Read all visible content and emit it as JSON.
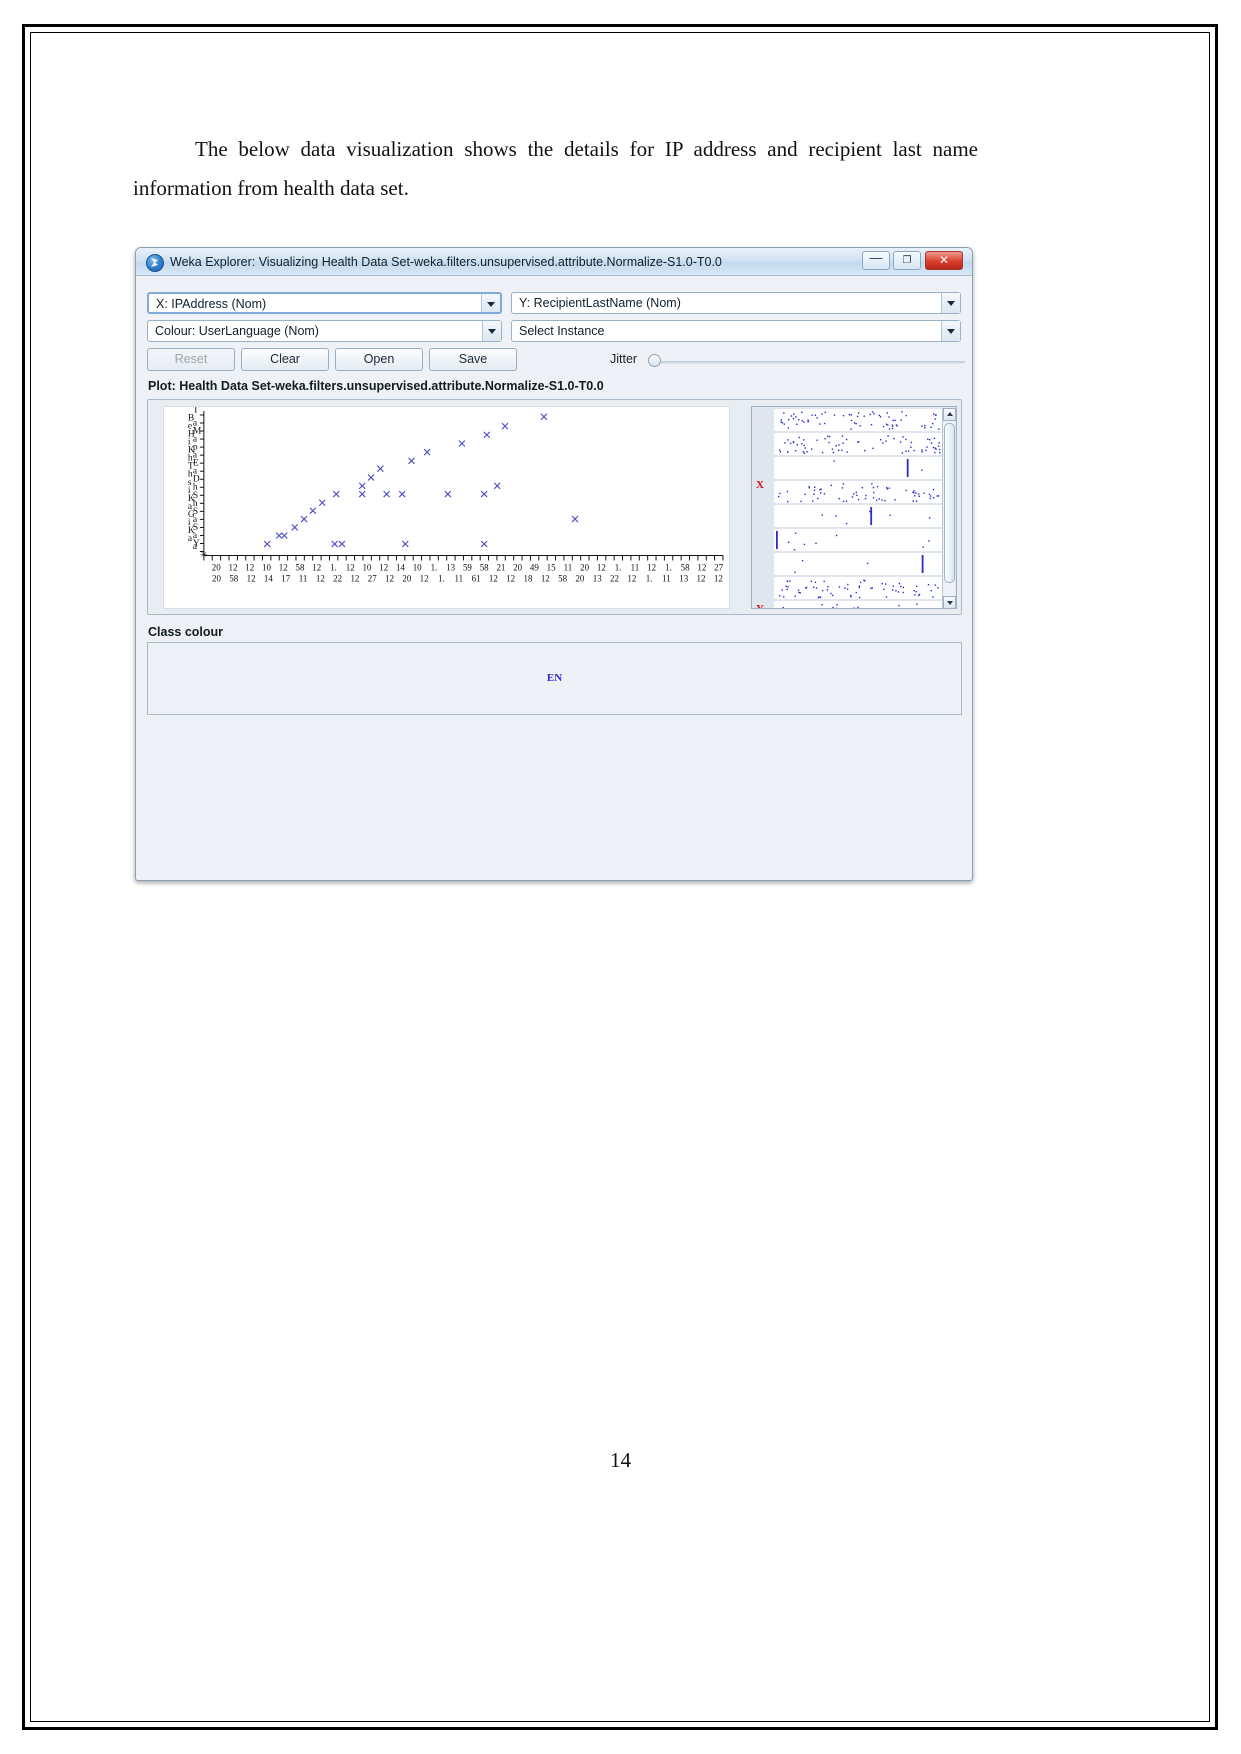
{
  "document": {
    "paragraph_indent": " ",
    "paragraph": "The below data visualization shows the details for IP address and recipient last name information from health data set.",
    "page_number": "14"
  },
  "window": {
    "title": "Weka Explorer: Visualizing Health Data Set-weka.filters.unsupervised.attribute.Normalize-S1.0-T0.0",
    "icon": "weka-bird-icon",
    "buttons": {
      "minimize": "—",
      "maximize": "❐",
      "close": "✕"
    }
  },
  "controls": {
    "x_attribute": "X: IPAddress (Nom)",
    "y_attribute": "Y: RecipientLastName (Nom)",
    "colour_attribute": "Colour: UserLanguage (Nom)",
    "select_instance": "Select Instance",
    "reset_label": "Reset",
    "clear_label": "Clear",
    "open_label": "Open",
    "save_label": "Save",
    "jitter_label": "Jitter"
  },
  "plot": {
    "title": "Plot: Health Data Set-weka.filters.unsupervised.attribute.Normalize-S1.0-T0.0",
    "x_mark": "X",
    "y_mark": "Y"
  },
  "class_colour": {
    "label": "Class colour",
    "value": "EN",
    "colour": "#2b2bd0"
  },
  "chart_data": {
    "type": "scatter",
    "title": "Plot: Health Data Set-weka.filters.unsupervised.attribute.Normalize-S1.0-T0.0",
    "xlabel": "IPAddress (Nom)",
    "ylabel": "RecipientLastName (Nom)",
    "grid": false,
    "legend": "EN",
    "point_colour": "#4a4ac8",
    "marker": "x",
    "y_categories": [
      "T",
      "Ba",
      "eM",
      "Ha",
      "ip",
      "Ka",
      "hE",
      "Ta",
      "hD",
      "sh",
      "iS",
      "Kh",
      "aS",
      "Ga",
      "iS",
      "Ka",
      "aY",
      "a"
    ],
    "y_labels_top_to_bottom": [
      "T",
      "Ba",
      "eM",
      "Ha",
      "ip",
      "Ka",
      "hE",
      "Ta",
      "hD",
      "sh",
      "iS",
      "Kh",
      "aS",
      "Ga",
      "iS",
      "Ka",
      "aY",
      "a"
    ],
    "x_tick_labels_row1": [
      "20",
      "12",
      "12",
      "10",
      "12",
      "58",
      "12",
      "1.",
      "12",
      "10",
      "12",
      "14",
      "10",
      "1.",
      "13",
      "59",
      "58",
      "21",
      "20",
      "49",
      "15",
      "11",
      "20",
      "12",
      "1.",
      "11",
      "12",
      "1.",
      "58",
      "12",
      "27"
    ],
    "x_tick_labels_row2": [
      "20",
      "58",
      "12",
      "14",
      "17",
      "11",
      "12",
      "22",
      "12",
      "27",
      "12",
      "20",
      "12",
      "1.",
      "11",
      "61",
      "12",
      "12",
      "18",
      "12",
      "58",
      "20",
      "13",
      "22",
      "12",
      "1.",
      "11",
      "13",
      "12",
      "12"
    ],
    "points": [
      {
        "x": 0.655,
        "y": 0.04
      },
      {
        "x": 0.58,
        "y": 0.105
      },
      {
        "x": 0.545,
        "y": 0.165
      },
      {
        "x": 0.497,
        "y": 0.225
      },
      {
        "x": 0.43,
        "y": 0.285
      },
      {
        "x": 0.4,
        "y": 0.345
      },
      {
        "x": 0.34,
        "y": 0.4
      },
      {
        "x": 0.322,
        "y": 0.46
      },
      {
        "x": 0.305,
        "y": 0.518
      },
      {
        "x": 0.565,
        "y": 0.518
      },
      {
        "x": 0.255,
        "y": 0.575
      },
      {
        "x": 0.305,
        "y": 0.575
      },
      {
        "x": 0.352,
        "y": 0.575
      },
      {
        "x": 0.382,
        "y": 0.575
      },
      {
        "x": 0.47,
        "y": 0.575
      },
      {
        "x": 0.54,
        "y": 0.575
      },
      {
        "x": 0.228,
        "y": 0.635
      },
      {
        "x": 0.21,
        "y": 0.69
      },
      {
        "x": 0.193,
        "y": 0.748
      },
      {
        "x": 0.715,
        "y": 0.748
      },
      {
        "x": 0.175,
        "y": 0.805
      },
      {
        "x": 0.145,
        "y": 0.862
      },
      {
        "x": 0.155,
        "y": 0.862
      },
      {
        "x": 0.122,
        "y": 0.92
      },
      {
        "x": 0.252,
        "y": 0.92
      },
      {
        "x": 0.266,
        "y": 0.92
      },
      {
        "x": 0.388,
        "y": 0.92
      },
      {
        "x": 0.54,
        "y": 0.92
      }
    ]
  }
}
